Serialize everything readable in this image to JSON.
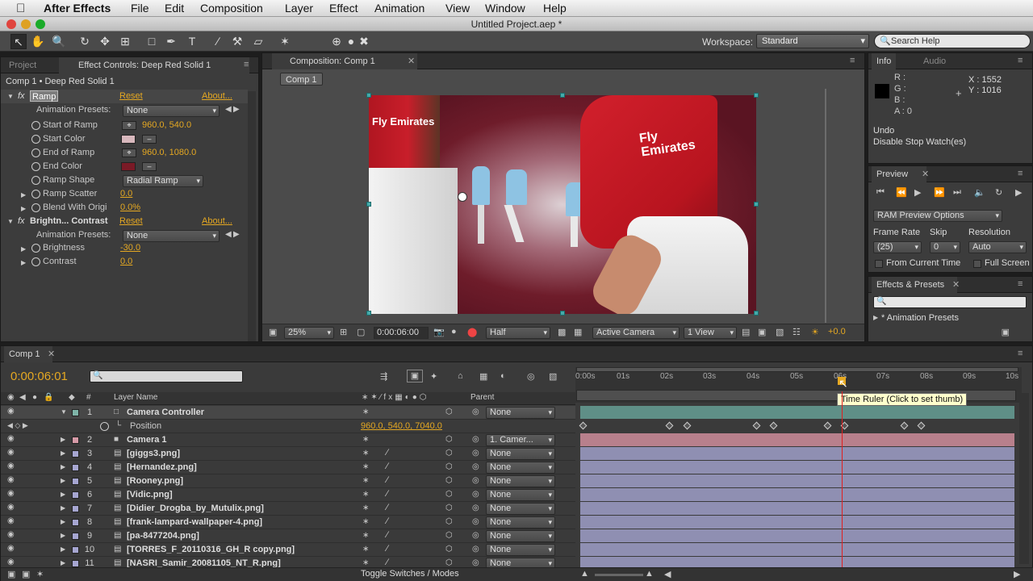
{
  "menubar": {
    "app": "After Effects",
    "items": [
      "File",
      "Edit",
      "Composition",
      "Layer",
      "Effect",
      "Animation",
      "View",
      "Window",
      "Help"
    ]
  },
  "window_title": "Untitled Project.aep *",
  "toolbar": {
    "workspace_label": "Workspace:",
    "workspace_value": "Standard",
    "search_placeholder": "Search Help"
  },
  "effect_panel": {
    "tab_project": "Project",
    "tab_effect": "Effect Controls: Deep Red Solid 1",
    "breadcrumb": "Comp 1 • Deep Red Solid 1",
    "ramp": {
      "name": "Ramp",
      "reset": "Reset",
      "about": "About...",
      "presets_label": "Animation Presets:",
      "presets_value": "None",
      "start_of_ramp_label": "Start of Ramp",
      "start_of_ramp_value": "960.0, 540.0",
      "start_color_label": "Start Color",
      "start_color": "#d8b8bd",
      "end_of_ramp_label": "End of Ramp",
      "end_of_ramp_value": "960.0, 1080.0",
      "end_color_label": "End Color",
      "end_color": "#7a1a26",
      "ramp_shape_label": "Ramp Shape",
      "ramp_shape_value": "Radial Ramp",
      "ramp_scatter_label": "Ramp Scatter",
      "ramp_scatter_value": "0.0",
      "blend_label": "Blend With Origi",
      "blend_value": "0.0%"
    },
    "bc": {
      "name": "Brightn... Contrast",
      "reset": "Reset",
      "about": "About...",
      "presets_label": "Animation Presets:",
      "presets_value": "None",
      "brightness_label": "Brightness",
      "brightness_value": "-30.0",
      "contrast_label": "Contrast",
      "contrast_value": "0.0"
    }
  },
  "comp_panel": {
    "tab": "Composition: Comp 1",
    "subtab": "Comp 1",
    "zoom": "25%",
    "timecode": "0:00:06:00",
    "resolution": "Half",
    "camera": "Active Camera",
    "views": "1 View",
    "exposure": "+0.0",
    "shirt_text": "Fly Emirates"
  },
  "info_panel": {
    "tab_info": "Info",
    "tab_audio": "Audio",
    "r": "R :",
    "g": "G :",
    "b": "B :",
    "a": "A : 0",
    "x": "X : 1552",
    "y": "Y : 1016",
    "undo_label": "Undo",
    "undo_action": "Disable Stop Watch(es)"
  },
  "preview_panel": {
    "tab": "Preview",
    "ram_options": "RAM Preview Options",
    "frame_rate_label": "Frame Rate",
    "frame_rate_value": "(25)",
    "skip_label": "Skip",
    "skip_value": "0",
    "resolution_label": "Resolution",
    "resolution_value": "Auto",
    "from_current": "From Current Time",
    "full_screen": "Full Screen"
  },
  "effects_presets_panel": {
    "tab": "Effects & Presets",
    "item": "* Animation Presets"
  },
  "timeline": {
    "tab": "Comp 1",
    "timecode": "0:00:06:01",
    "col_layer_name": "Layer Name",
    "col_parent": "Parent",
    "tooltip": "Time Ruler (Click to set thumb)",
    "toggle": "Toggle Switches / Modes",
    "ticks": [
      "0:00s",
      "01s",
      "02s",
      "03s",
      "04s",
      "05s",
      "06s",
      "07s",
      "08s",
      "09s",
      "10s"
    ],
    "position_label": "Position",
    "position_value": "960.0, 540.0, 7040.0",
    "layers": [
      {
        "num": "1",
        "name": "Camera Controller",
        "parent": "None",
        "color": "#7fb4a8"
      },
      {
        "num": "2",
        "name": "Camera 1",
        "parent": "1. Camer...",
        "color": "#d69aa7"
      },
      {
        "num": "3",
        "name": "[giggs3.png]",
        "parent": "None",
        "color": "#a6a6d1"
      },
      {
        "num": "4",
        "name": "[Hernandez.png]",
        "parent": "None",
        "color": "#a6a6d1"
      },
      {
        "num": "5",
        "name": "[Rooney.png]",
        "parent": "None",
        "color": "#a6a6d1"
      },
      {
        "num": "6",
        "name": "[Vidic.png]",
        "parent": "None",
        "color": "#a6a6d1"
      },
      {
        "num": "7",
        "name": "[Didier_Drogba_by_Mutulix.png]",
        "parent": "None",
        "color": "#a6a6d1"
      },
      {
        "num": "8",
        "name": "[frank-lampard-wallpaper-4.png]",
        "parent": "None",
        "color": "#a6a6d1"
      },
      {
        "num": "9",
        "name": "[pa-8477204.png]",
        "parent": "None",
        "color": "#a6a6d1"
      },
      {
        "num": "10",
        "name": "[TORRES_F_20110316_GH_R copy.png]",
        "parent": "None",
        "color": "#a6a6d1"
      },
      {
        "num": "11",
        "name": "[NASRI_Samir_20081105_NT_R.png]",
        "parent": "None",
        "color": "#a6a6d1"
      }
    ]
  }
}
